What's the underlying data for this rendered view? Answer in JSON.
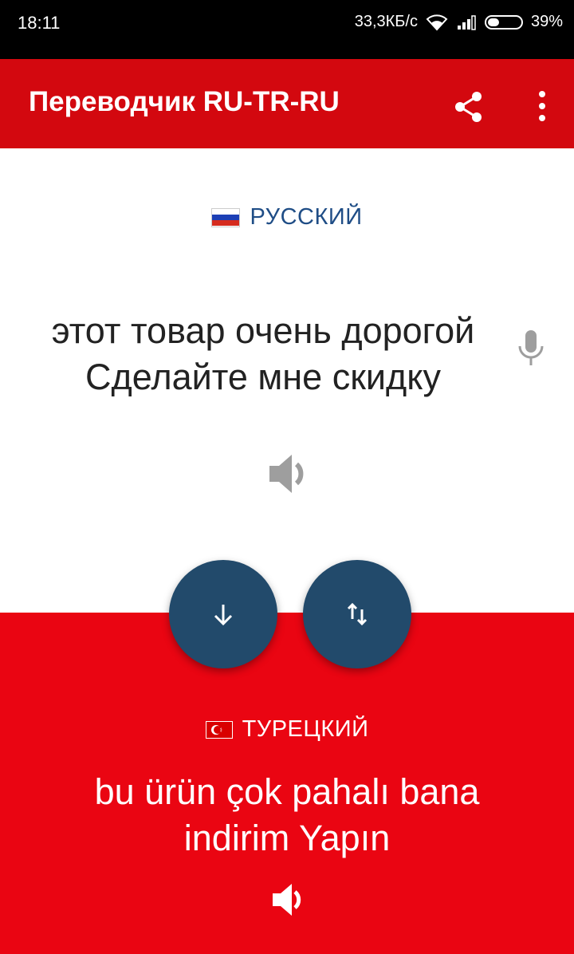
{
  "status_bar": {
    "time": "18:11",
    "network_speed": "33,3КБ/с",
    "battery": "39%",
    "icons": [
      "wifi-icon",
      "signal-icon",
      "battery-icon"
    ]
  },
  "app_bar": {
    "title": "Переводчик RU-TR-RU",
    "icons": [
      "share-icon",
      "more-vert-icon"
    ],
    "color": "#d3080f"
  },
  "source": {
    "language": "РУССКИЙ",
    "text_line1": "этот товар очень дорогой",
    "text_line2": "Сделайте мне скидку",
    "icons": [
      "russia-flag-icon",
      "microphone-icon",
      "speaker-icon"
    ]
  },
  "actions": {
    "icons": [
      "arrow-down-icon",
      "swap-vertical-icon"
    ],
    "color": "#224a6b"
  },
  "target": {
    "language": "ТУРЕЦКИЙ",
    "text_line1": "bu ürün çok pahalı bana",
    "text_line2": "indirim Yapın",
    "icons": [
      "turkey-flag-icon",
      "speaker-icon"
    ],
    "color": "#ea0512"
  }
}
